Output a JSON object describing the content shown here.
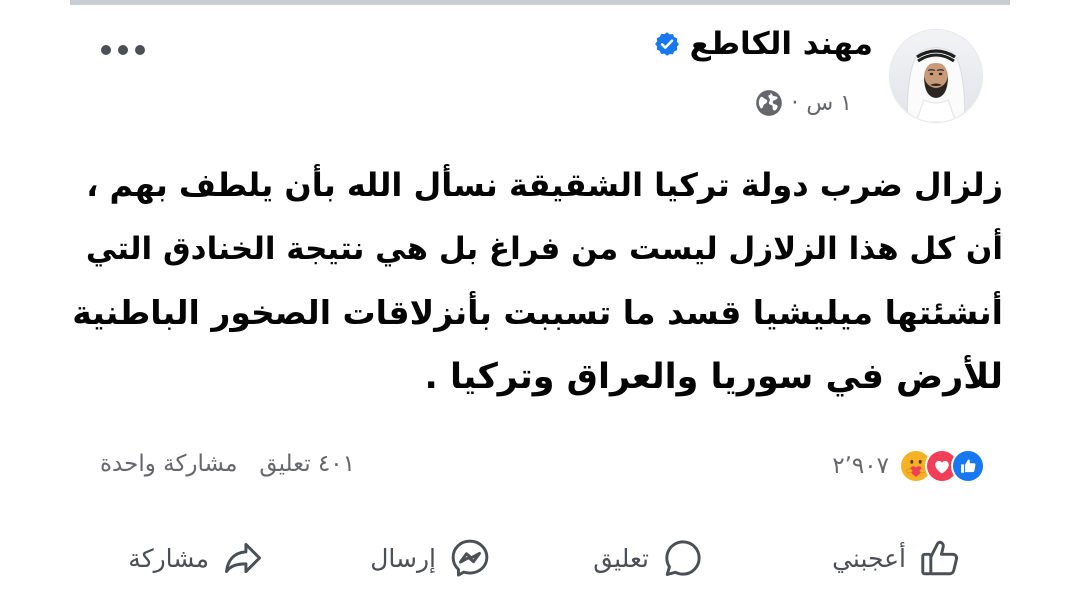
{
  "colors": {
    "accent": "#1877f2",
    "text": "#050505",
    "muted": "#65676b",
    "icon": "#4b4f56",
    "divider": "#c9ccd1"
  },
  "post": {
    "avatar": "author-avatar-photo",
    "author_name": "مهند الكاطع",
    "verified_icon": "verified-badge-icon",
    "time": "١ س",
    "separator": "·",
    "audience_icon": "globe-icon",
    "more_icon": "more-options-icon",
    "text_lines": [
      "زلزال ضرب دولة تركيا الشقيقة نسأل الله بأن يلطف بهم ،",
      "أن كل هذا الزلازل ليست من فراغ بل هي نتيجة الخنادق التي",
      "أنشئتها ميليشيا قسد ما تسببت بأنزلاقات الصخور الباطنية",
      "للأرض في سوريا والعراق وتركيا ."
    ]
  },
  "stats": {
    "reaction_icons": [
      "like-reaction-icon",
      "love-reaction-icon",
      "care-reaction-icon"
    ],
    "reaction_count": "٢٬٩٠٧",
    "comments": "٤٠١ تعليق",
    "shares": "مشاركة واحدة"
  },
  "actions": [
    {
      "label": "أعجبني",
      "icon": "thumbs-up-icon"
    },
    {
      "label": "تعليق",
      "icon": "comment-icon"
    },
    {
      "label": "إرسال",
      "icon": "messenger-icon"
    },
    {
      "label": "مشاركة",
      "icon": "share-icon"
    }
  ]
}
